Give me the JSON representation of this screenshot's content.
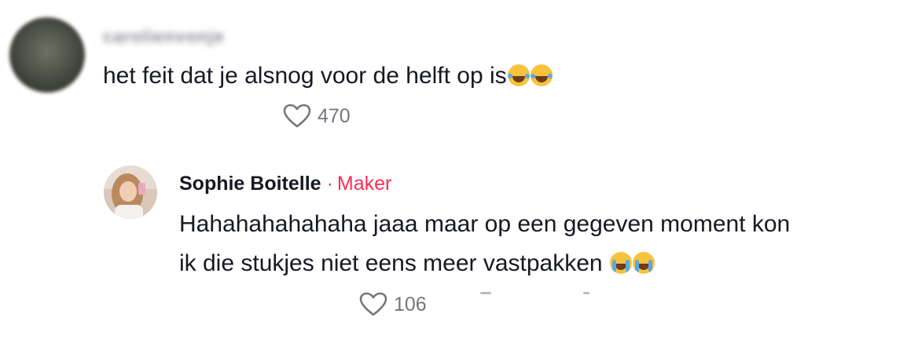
{
  "comment1": {
    "username": "carolienvonje",
    "text": "het feit dat je alsnog voor de helft op is",
    "emojis": [
      "face-with-tears-of-joy",
      "face-with-tears-of-joy"
    ],
    "likes": "470"
  },
  "reply1": {
    "author": "Sophie Boitelle",
    "separator": "·",
    "role": "Maker",
    "text_line1": "Hahahahahahaha jaaa maar op een gegeven moment kon",
    "text_line2": "ik die stukjes niet eens meer vastpakken",
    "emojis": [
      "loudly-crying-face",
      "loudly-crying-face"
    ],
    "likes": "106"
  },
  "colors": {
    "text": "#161823",
    "secondary": "#75767c",
    "maker_accent": "#fe2c55"
  }
}
